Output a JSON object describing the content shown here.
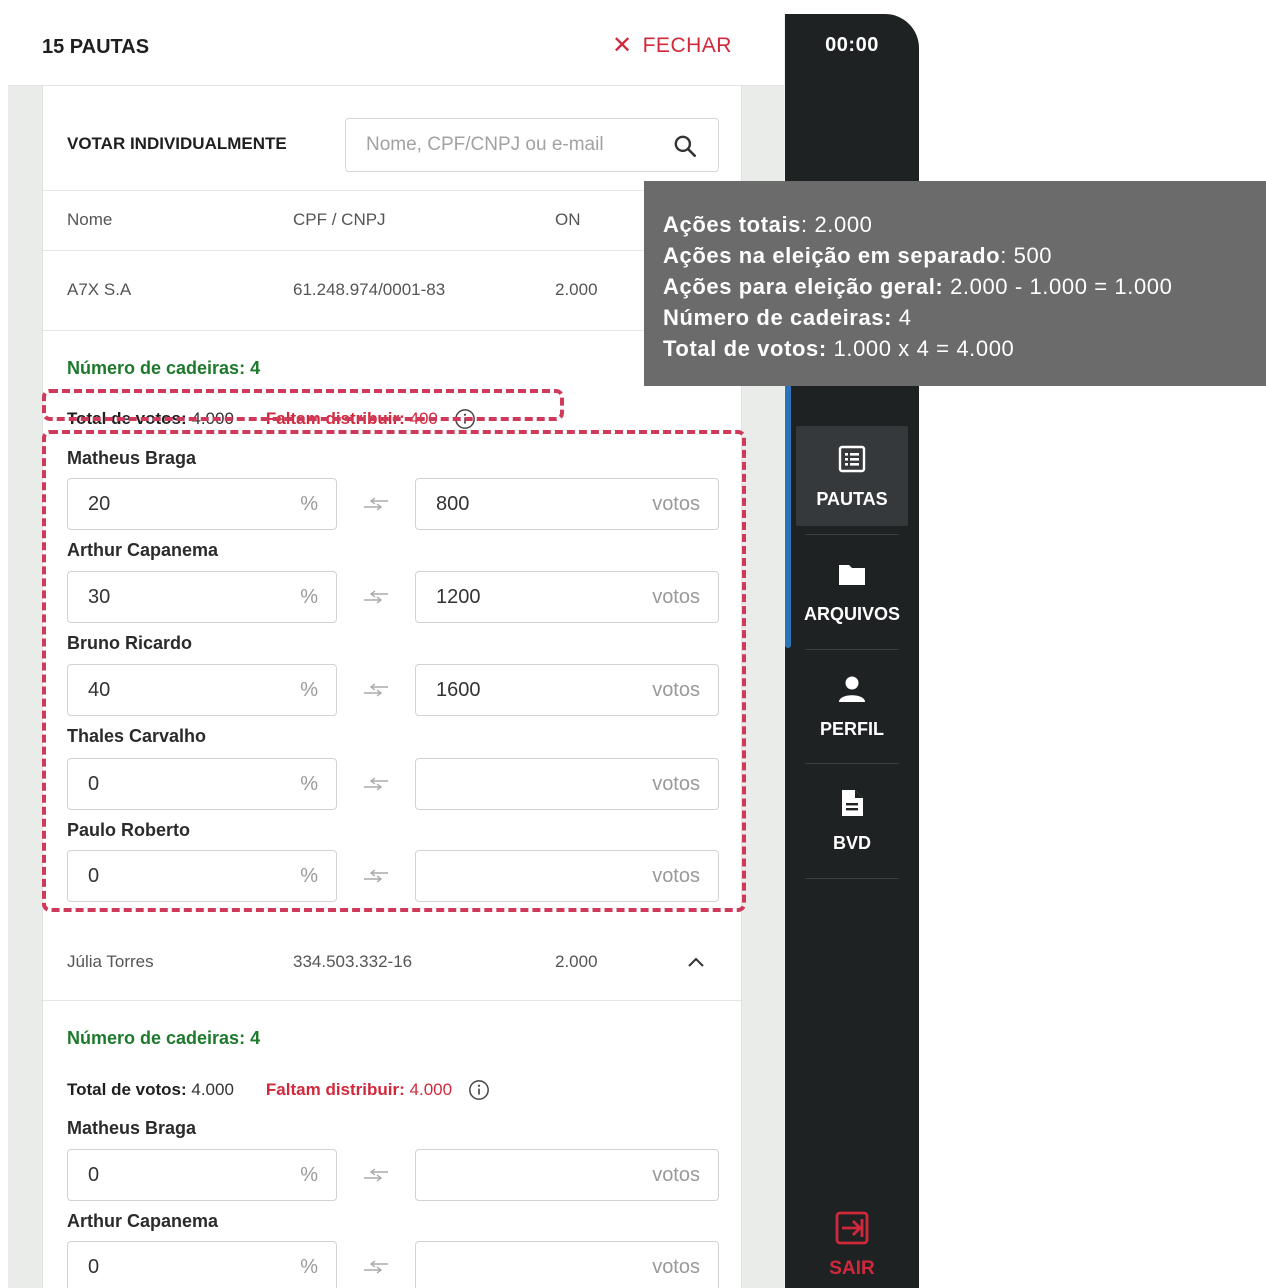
{
  "header": {
    "title": "15 PAUTAS",
    "close_label": "FECHAR"
  },
  "search": {
    "label": "VOTAR INDIVIDUALMENTE",
    "placeholder": "Nome, CPF/CNPJ ou e-mail"
  },
  "table": {
    "columns": [
      "Nome",
      "CPF / CNPJ",
      "ON"
    ],
    "rows": [
      {
        "name": "A7X S.A",
        "doc": "61.248.974/0001-83",
        "on": "2.000",
        "seats_label": "Número de cadeiras:",
        "seats": "4",
        "total_label": "Total de votos:",
        "total": "4.000",
        "remaining_label": "Faltam distribuir:",
        "remaining": "400",
        "candidates": [
          {
            "name": "Matheus Braga",
            "pct": "20",
            "votes": "800"
          },
          {
            "name": "Arthur Capanema",
            "pct": "30",
            "votes": "1200"
          },
          {
            "name": "Bruno Ricardo",
            "pct": "40",
            "votes": "1600"
          },
          {
            "name": "Thales Carvalho",
            "pct": "0",
            "votes": ""
          },
          {
            "name": "Paulo Roberto",
            "pct": "0",
            "votes": ""
          }
        ]
      },
      {
        "name": "Júlia Torres",
        "doc": "334.503.332-16",
        "on": "2.000",
        "seats_label": "Número de cadeiras:",
        "seats": "4",
        "total_label": "Total de votos:",
        "total": "4.000",
        "remaining_label": "Faltam distribuir:",
        "remaining": "4.000",
        "candidates": [
          {
            "name": "Matheus Braga",
            "pct": "0",
            "votes": ""
          },
          {
            "name": "Arthur Capanema",
            "pct": "0",
            "votes": ""
          }
        ]
      }
    ],
    "pct_unit": "%",
    "votes_unit": "votos"
  },
  "sidebar": {
    "timer": "00:00",
    "items": [
      {
        "label": "PAUTAS",
        "icon": "list-icon",
        "active": true
      },
      {
        "label": "ARQUIVOS",
        "icon": "folder-icon",
        "active": false
      },
      {
        "label": "PERFIL",
        "icon": "user-icon",
        "active": false
      },
      {
        "label": "BVD",
        "icon": "document-icon",
        "active": false
      }
    ],
    "logout_label": "SAIR"
  },
  "tooltip": {
    "lines": [
      {
        "label": "Ações totais",
        "value": ": 2.000"
      },
      {
        "label": "Ações na eleição em separado",
        "value": ": 500"
      },
      {
        "label": "Ações para eleição geral:",
        "value": " 2.000 - 1.000 = 1.000"
      },
      {
        "label": "Número de cadeiras:",
        "value": " 4"
      },
      {
        "label": "Total de votos:",
        "value": " 1.000 x 4 = 4.000"
      }
    ]
  },
  "colors": {
    "accent_red": "#d2283c",
    "seats_green": "#1d7a2c",
    "sidebar_bg": "#1f2223",
    "highlight_dash": "#d03a5a"
  }
}
